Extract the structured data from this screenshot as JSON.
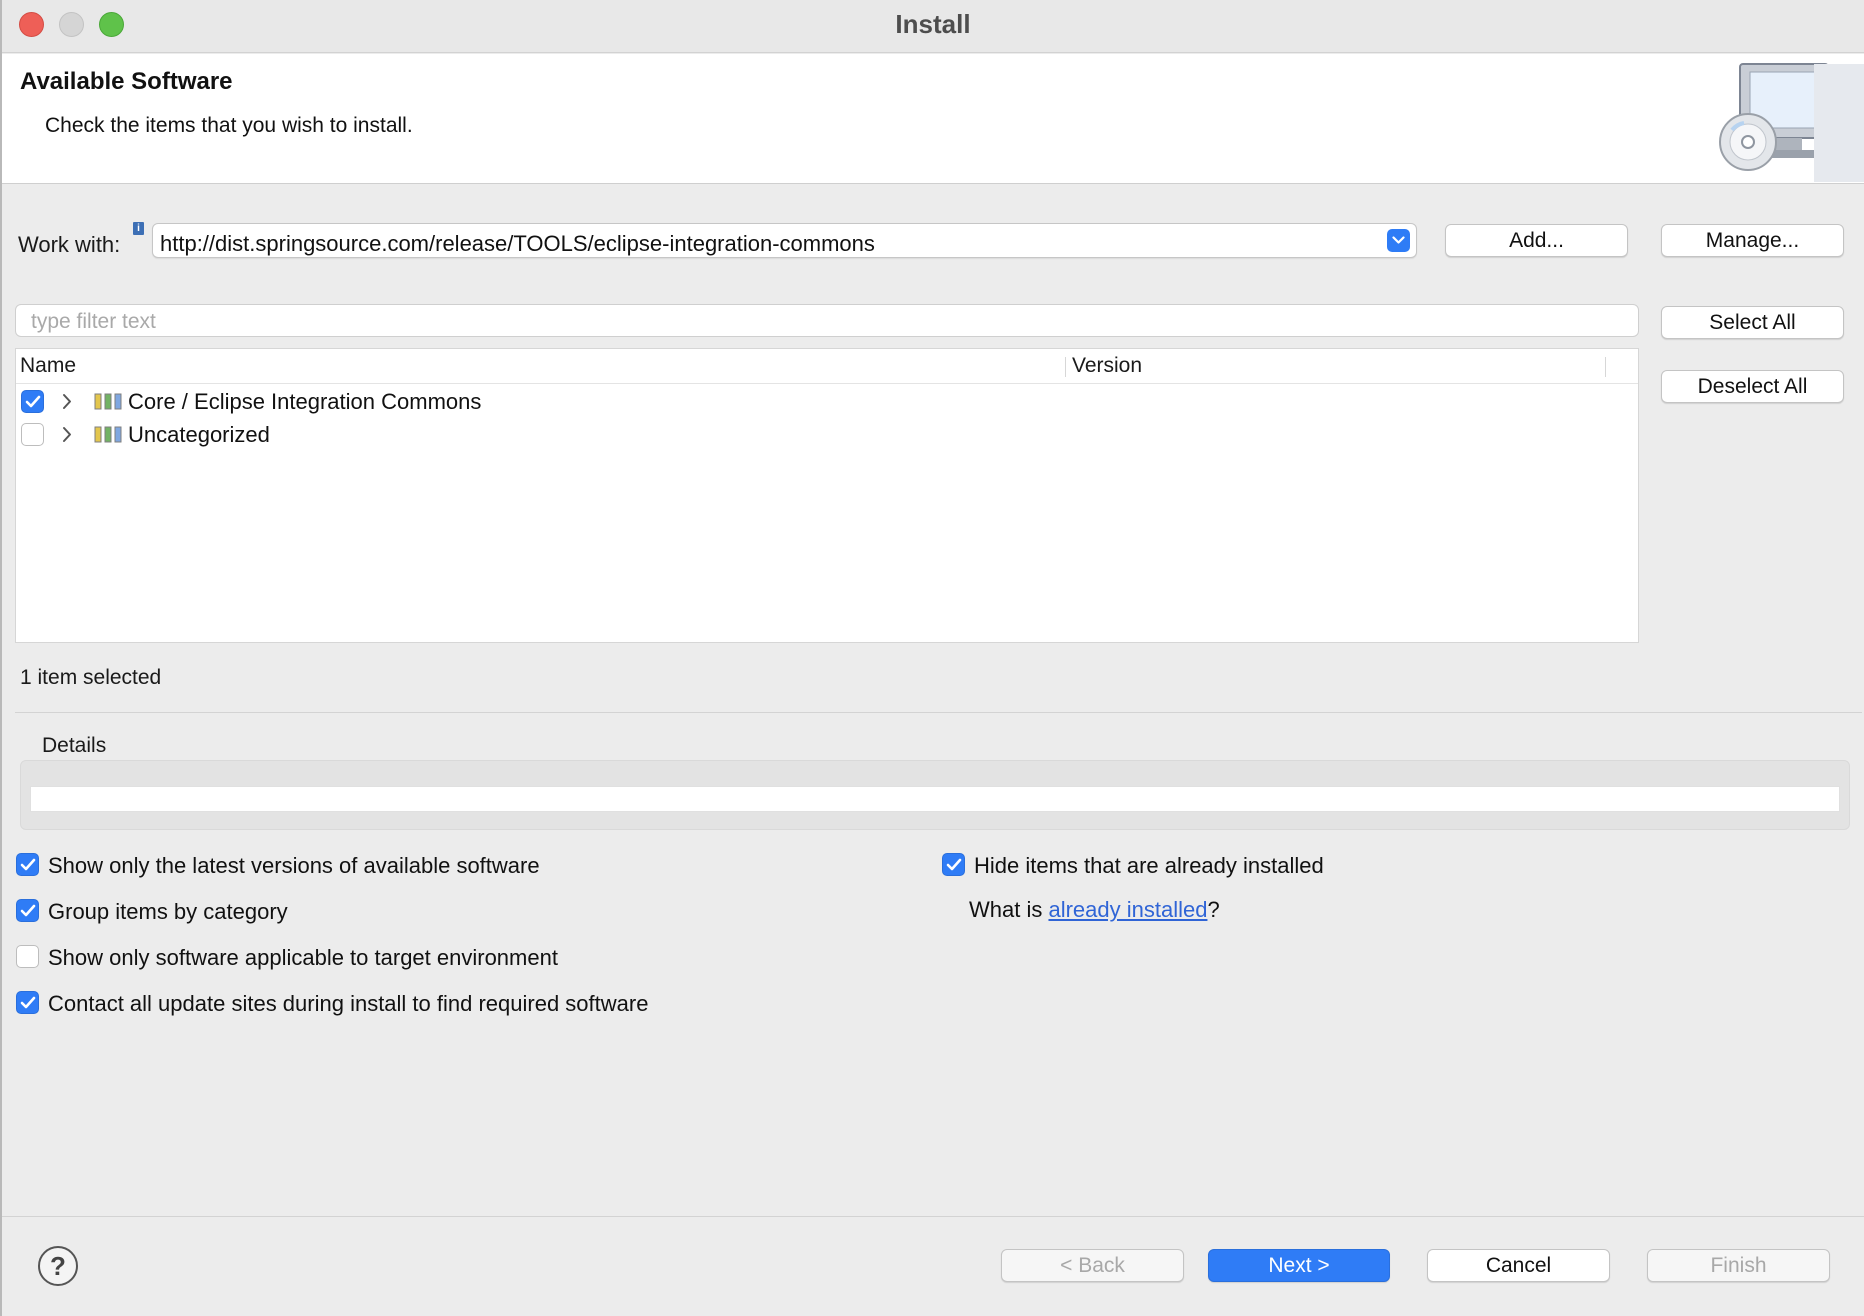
{
  "window": {
    "title": "Install"
  },
  "header": {
    "title": "Available Software",
    "subtitle": "Check the items that you wish to install."
  },
  "work_with": {
    "label": "Work with:",
    "value": "http://dist.springsource.com/release/TOOLS/eclipse-integration-commons",
    "add_label": "Add...",
    "manage_label": "Manage..."
  },
  "filter": {
    "placeholder": "type filter text"
  },
  "selection_buttons": {
    "select_all": "Select All",
    "deselect_all": "Deselect All"
  },
  "table": {
    "columns": [
      "Name",
      "Version"
    ],
    "rows": [
      {
        "label": "Core / Eclipse Integration Commons",
        "checked": true
      },
      {
        "label": "Uncategorized",
        "checked": false
      }
    ]
  },
  "status": {
    "selected_count": "1 item selected"
  },
  "details": {
    "label": "Details"
  },
  "options": {
    "latest_versions": {
      "label": "Show only the latest versions of available software",
      "checked": true
    },
    "group_by_category": {
      "label": "Group items by category",
      "checked": true
    },
    "target_env": {
      "label": "Show only software applicable to target environment",
      "checked": false
    },
    "contact_sites": {
      "label": "Contact all update sites during install to find required software",
      "checked": true
    },
    "hide_installed": {
      "label": "Hide items that are already installed",
      "checked": true
    }
  },
  "what_is": {
    "prefix": "What is ",
    "link": "already installed",
    "suffix": "?"
  },
  "footer": {
    "back": "< Back",
    "next": "Next >",
    "cancel": "Cancel",
    "finish": "Finish",
    "help": "?"
  },
  "colors": {
    "accent": "#2f7cf6",
    "link": "#2f64d6",
    "close": "#ee5f57",
    "maximize": "#5fc24a"
  }
}
